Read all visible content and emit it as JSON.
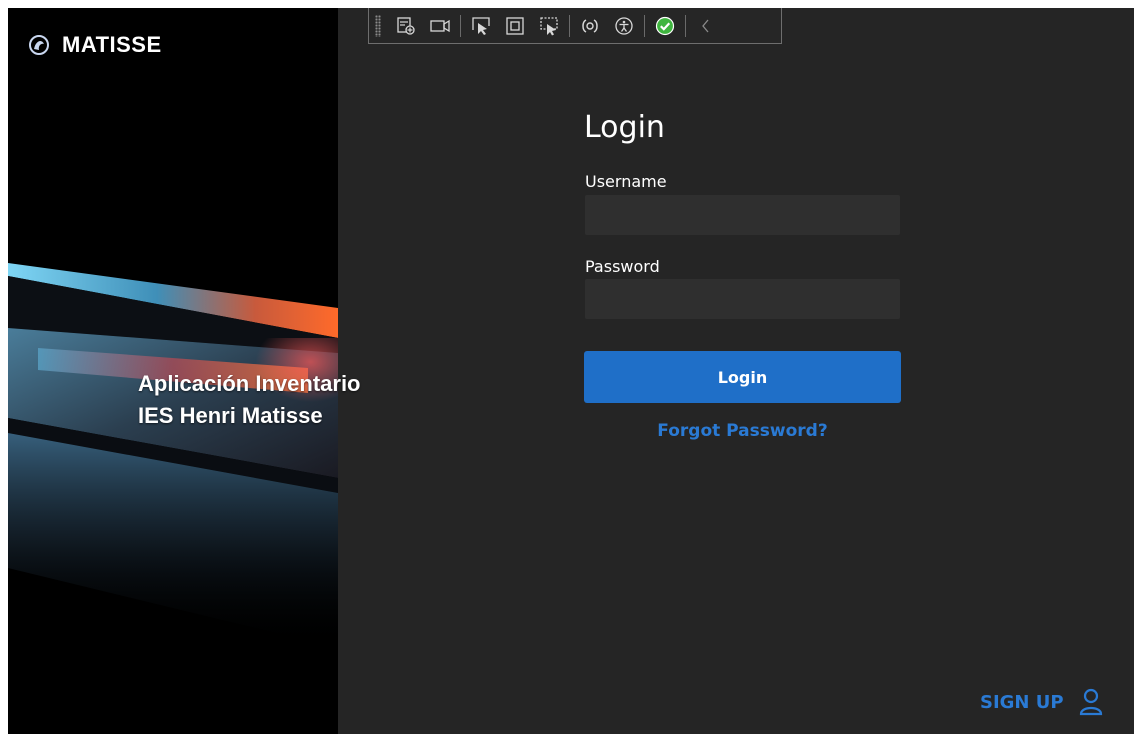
{
  "brand": {
    "name": "MATISSE"
  },
  "hero": {
    "caption_line1": "Aplicación Inventario",
    "caption_line2": "IES Henri Matisse"
  },
  "toolbar": {
    "buttons": [
      "live-visual-tree-icon",
      "video-camera-icon",
      "select-element-icon",
      "display-layout-adorners-icon",
      "track-focused-element-icon",
      "binding-failures-icon",
      "accessibility-icon",
      "check-circle-icon",
      "chevron-left-icon"
    ]
  },
  "login": {
    "title": "Login",
    "username_label": "Username",
    "username_value": "",
    "password_label": "Password",
    "password_value": "",
    "submit_label": "Login",
    "forgot_label": "Forgot Password?"
  },
  "signup": {
    "label": "SIGN UP",
    "icon": "user-icon"
  },
  "colors": {
    "background": "#252525",
    "accent": "#1f6fc8",
    "link": "#2a7ad4",
    "input_bg": "#2f2f2f",
    "check_green": "#3fb53f"
  }
}
